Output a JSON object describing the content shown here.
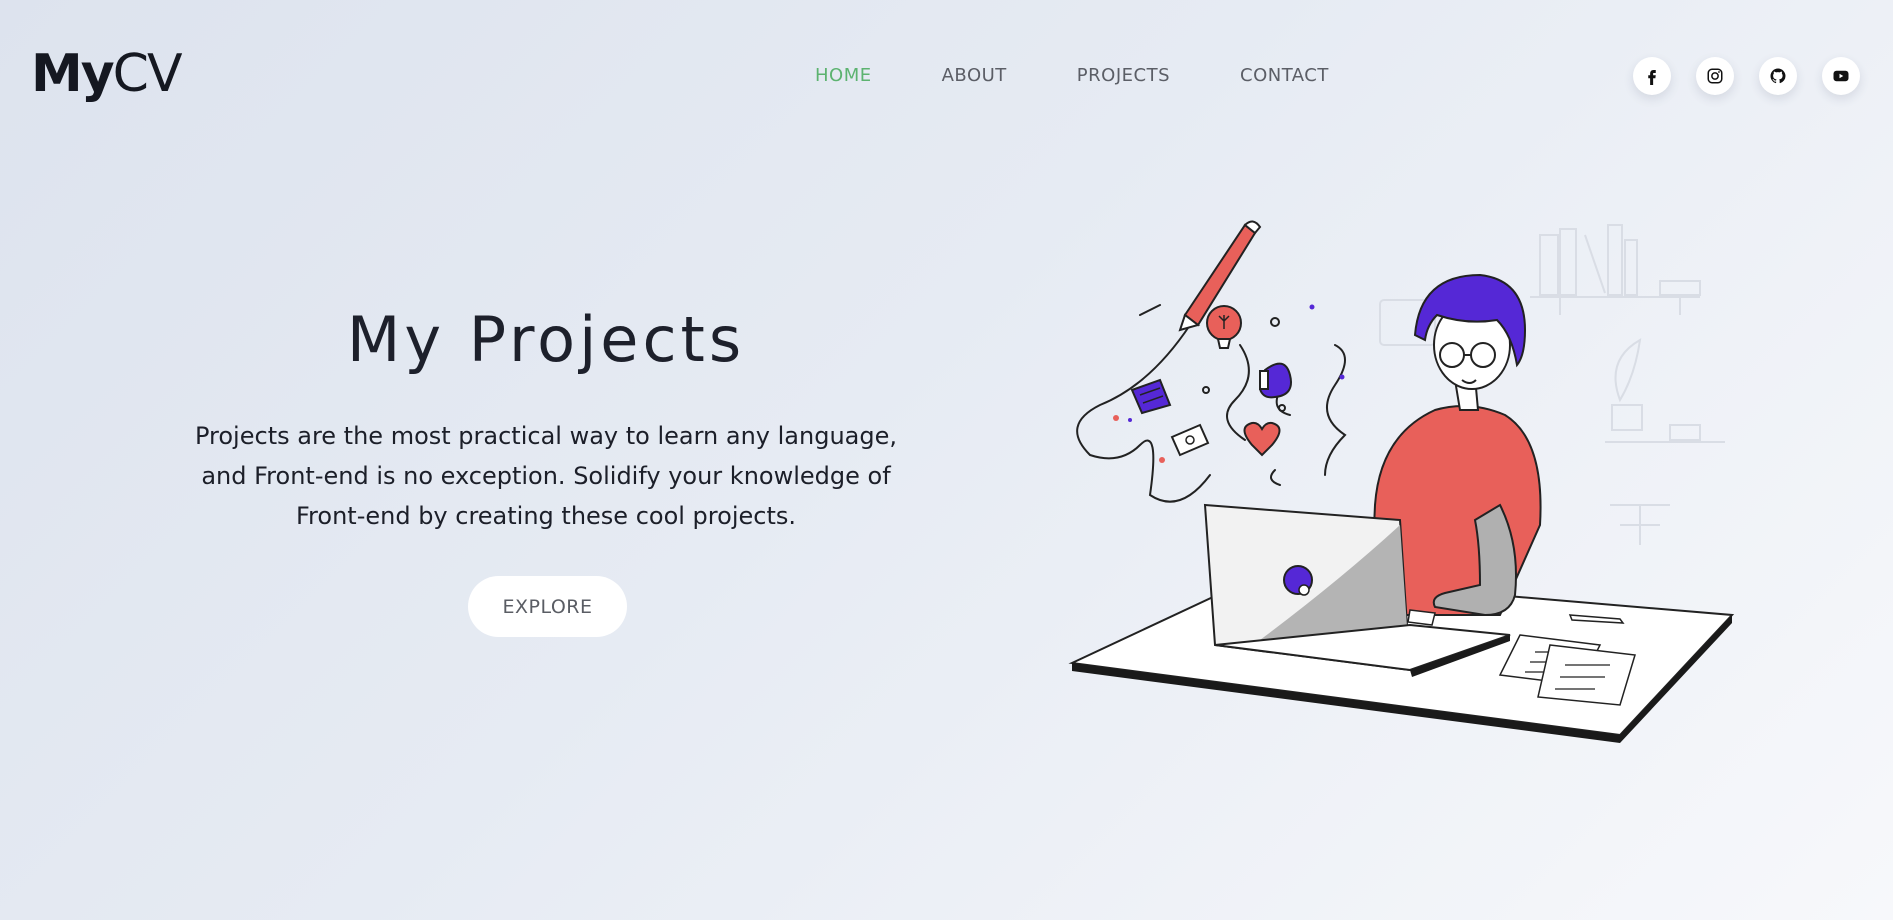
{
  "logo": {
    "part1": "My",
    "part2": "CV"
  },
  "nav": {
    "items": [
      {
        "label": "HOME",
        "active": true
      },
      {
        "label": "ABOUT",
        "active": false
      },
      {
        "label": "PROJECTS",
        "active": false
      },
      {
        "label": "CONTACT",
        "active": false
      }
    ]
  },
  "social": {
    "icons": [
      "facebook-icon",
      "instagram-icon",
      "github-icon",
      "youtube-icon"
    ]
  },
  "hero": {
    "title": "My Projects",
    "description": "Projects are the most practical way to learn any language, and Front-end is no exception. Solidify your knowledge of Front-end by creating these cool projects.",
    "button_label": "EXPLORE"
  },
  "colors": {
    "active_nav": "#5cb370",
    "accent_red": "#e8605a",
    "accent_purple": "#5528d6",
    "text_dark": "#1d202b"
  }
}
